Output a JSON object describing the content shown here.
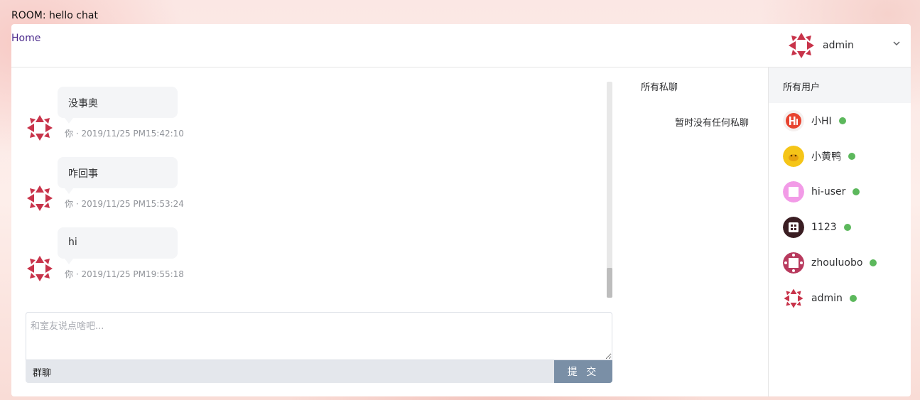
{
  "room": {
    "title": "ROOM: hello chat"
  },
  "header": {
    "home_label": "Home",
    "current_user": "admin",
    "dropdown_icon": "chevron-down-icon"
  },
  "messages": [
    {
      "text": "没事奥",
      "meta": "你 · 2019/11/25 PM15:42:10"
    },
    {
      "text": "咋回事",
      "meta": "你 · 2019/11/25 PM15:53:24"
    },
    {
      "text": "hi",
      "meta": "你 · 2019/11/25 PM19:55:18"
    }
  ],
  "composer": {
    "placeholder": "和室友说点啥吧...",
    "mode_label": "群聊",
    "submit_label": "提 交"
  },
  "private_chats": {
    "title": "所有私聊",
    "empty_text": "暂时没有任何私聊"
  },
  "users": {
    "title": "所有用户",
    "list": [
      {
        "name": "小HI",
        "online": true
      },
      {
        "name": "小黄鸭",
        "online": true
      },
      {
        "name": "hi-user",
        "online": true
      },
      {
        "name": "1123",
        "online": true
      },
      {
        "name": "zhouluobo",
        "online": true
      },
      {
        "name": "admin",
        "online": true
      }
    ]
  },
  "colors": {
    "accent": "#7a8fa6",
    "online": "#5cb85c",
    "avatar_red": "#c8334a",
    "link": "#4b2a8c"
  }
}
